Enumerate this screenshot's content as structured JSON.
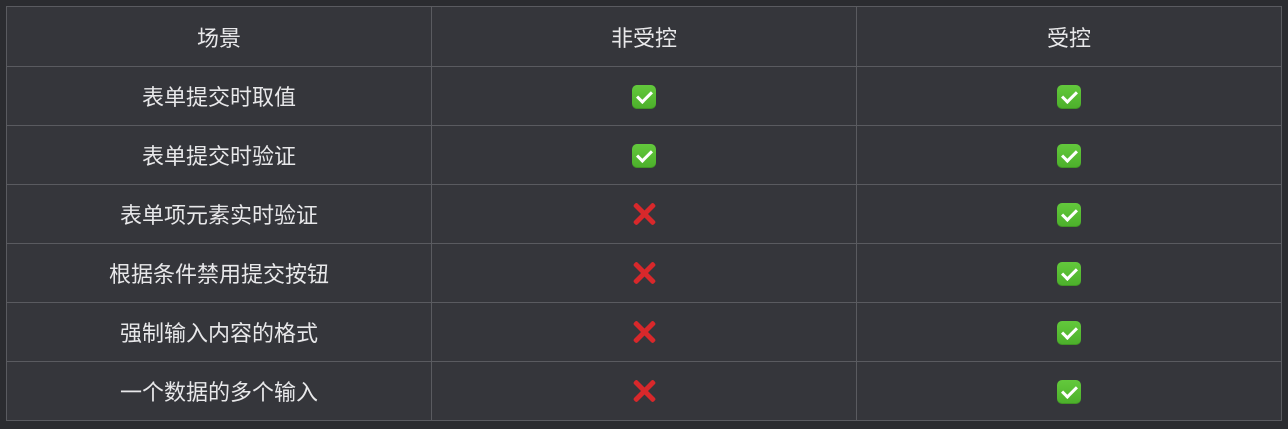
{
  "headers": [
    "场景",
    "非受控",
    "受控"
  ],
  "rows": [
    {
      "scenario": "表单提交时取值",
      "uncontrolled": "check",
      "controlled": "check"
    },
    {
      "scenario": "表单提交时验证",
      "uncontrolled": "check",
      "controlled": "check"
    },
    {
      "scenario": "表单项元素实时验证",
      "uncontrolled": "cross",
      "controlled": "check"
    },
    {
      "scenario": "根据条件禁用提交按钮",
      "uncontrolled": "cross",
      "controlled": "check"
    },
    {
      "scenario": "强制输入内容的格式",
      "uncontrolled": "cross",
      "controlled": "check"
    },
    {
      "scenario": "一个数据的多个输入",
      "uncontrolled": "cross",
      "controlled": "check"
    }
  ],
  "icons": {
    "check": "check-mark-icon",
    "cross": "cross-mark-icon"
  },
  "colors": {
    "background": "#2b2c30",
    "cell": "#35363b",
    "border": "#5a5b60",
    "text": "#e8e8ea",
    "check": "#4caf2b",
    "cross": "#d8282b"
  }
}
